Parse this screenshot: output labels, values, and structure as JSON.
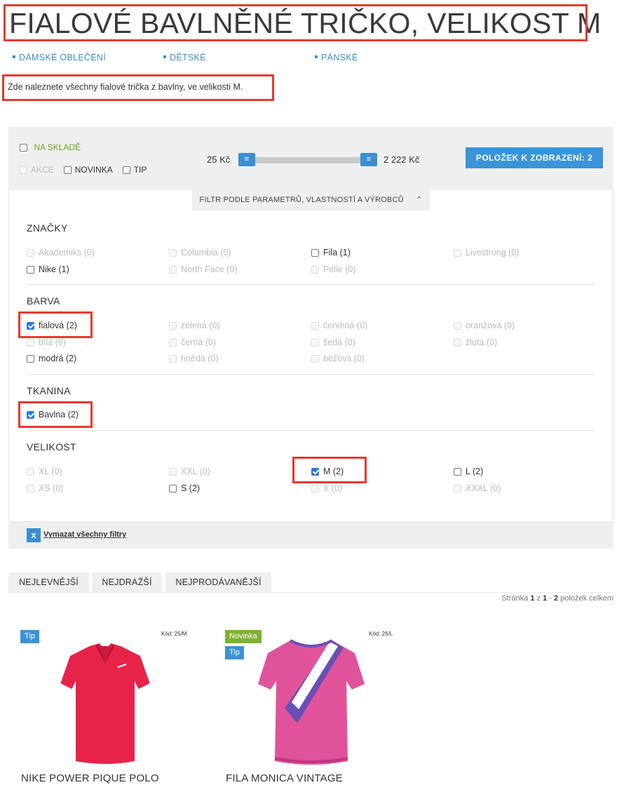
{
  "page": {
    "title": "FIALOVÉ BAVLNĚNÉ TRIČKO, VELIKOST M",
    "description": "Zde naleznete všechny fialové trička z bavlny, ve velikosti M."
  },
  "categories": [
    "DÁMSKÉ OBLEČENÍ",
    "DĚTSKÉ",
    "PÁNSKÉ"
  ],
  "top_filters": {
    "in_stock": "NA SKLADĚ",
    "action": "AKCE",
    "new": "NOVINKA",
    "tip": "TIP",
    "price_min": "25 Kč",
    "price_max": "2 222 Kč",
    "show_button": "POLOŽEK K ZOBRAZENÍ: 2",
    "param_tab": "FILTR PODLE PARAMETRŮ, VLASTNOSTÍ A VÝROBCŮ"
  },
  "filter_groups": {
    "brands": {
      "title": "ZNAČKY",
      "items": [
        {
          "label": "Akademiks (0)",
          "state": "disabled"
        },
        {
          "label": "Columbia (0)",
          "state": "disabled"
        },
        {
          "label": "Fila (1)",
          "state": "off"
        },
        {
          "label": "Livestrong (0)",
          "state": "disabled"
        },
        {
          "label": "Nike (1)",
          "state": "off"
        },
        {
          "label": "North Face (0)",
          "state": "disabled"
        },
        {
          "label": "Pelle (0)",
          "state": "disabled"
        }
      ]
    },
    "color": {
      "title": "BARVA",
      "items": [
        {
          "label": "fialová (2)",
          "state": "on"
        },
        {
          "label": "zelená (0)",
          "state": "disabled"
        },
        {
          "label": "červená (0)",
          "state": "disabled"
        },
        {
          "label": "oranžová (0)",
          "state": "disabled"
        },
        {
          "label": "bílá (0)",
          "state": "disabled"
        },
        {
          "label": "černá (0)",
          "state": "disabled"
        },
        {
          "label": "šedá (0)",
          "state": "disabled"
        },
        {
          "label": "žlutá (0)",
          "state": "disabled"
        },
        {
          "label": "modrá (2)",
          "state": "off"
        },
        {
          "label": "hnědá (0)",
          "state": "disabled"
        },
        {
          "label": "béžová (0)",
          "state": "disabled"
        }
      ]
    },
    "fabric": {
      "title": "TKANINA",
      "items": [
        {
          "label": "Bavlna (2)",
          "state": "on"
        }
      ]
    },
    "size": {
      "title": "VELIKOST",
      "items": [
        {
          "label": "XL (0)",
          "state": "disabled"
        },
        {
          "label": "XXL (0)",
          "state": "disabled"
        },
        {
          "label": "M (2)",
          "state": "on"
        },
        {
          "label": "L (2)",
          "state": "off"
        },
        {
          "label": "XS (0)",
          "state": "disabled"
        },
        {
          "label": "S (2)",
          "state": "off"
        },
        {
          "label": "X (0)",
          "state": "disabled"
        },
        {
          "label": "XXXL (0)",
          "state": "disabled"
        }
      ]
    }
  },
  "clear_filters": "Vymazat všechny filtry",
  "clear_icon": "x",
  "sort_tabs": [
    "NEJLEVNĚJŠÍ",
    "NEJDRAŽŠÍ",
    "NEJPRODÁVANĚJŠÍ"
  ],
  "pager": {
    "prefix": "Stránka",
    "page": "1",
    "of": "z",
    "range_from": "1",
    "range_dash": "-",
    "range_to": "2",
    "suffix": "položek celkem"
  },
  "products": [
    {
      "name": "NIKE POWER PIQUE POLO",
      "code": "Kód: 25/M",
      "badges": [
        "Tip"
      ],
      "color": "#e8234a"
    },
    {
      "name": "FILA MONICA VINTAGE",
      "code": "Kód: 26/L",
      "badges": [
        "Novinka",
        "Tip"
      ],
      "color": "#e0539a"
    }
  ],
  "colors": {
    "accent": "#3a94d8",
    "highlight": "#e53a2f",
    "stock": "#6aa425",
    "new_badge": "#7fb136"
  }
}
